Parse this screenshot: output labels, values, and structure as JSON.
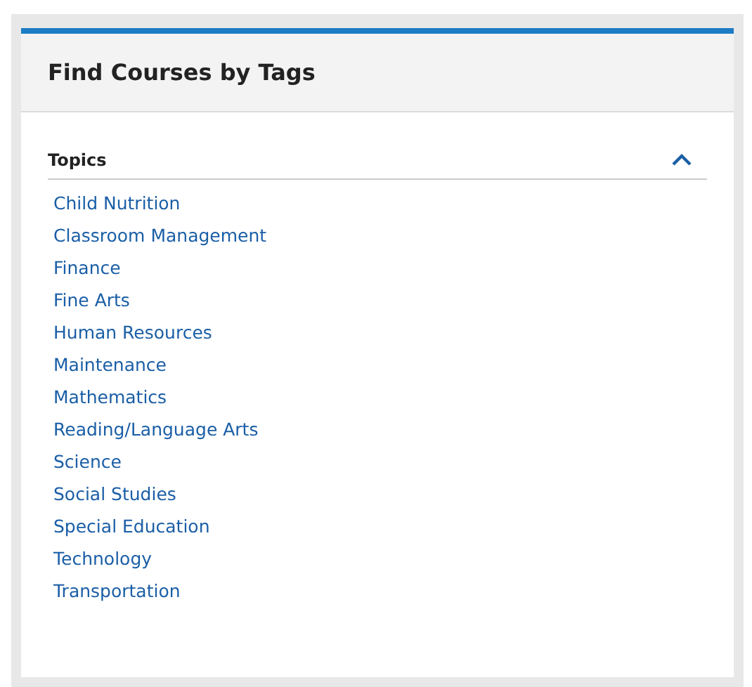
{
  "panel": {
    "title": "Find Courses by Tags"
  },
  "sections": [
    {
      "title": "Topics",
      "expanded": true,
      "items": [
        "Child Nutrition",
        "Classroom Management",
        "Finance",
        "Fine Arts",
        "Human Resources",
        "Maintenance",
        "Mathematics",
        "Reading/Language Arts",
        "Science",
        "Social Studies",
        "Special Education",
        "Technology",
        "Transportation"
      ]
    }
  ]
}
